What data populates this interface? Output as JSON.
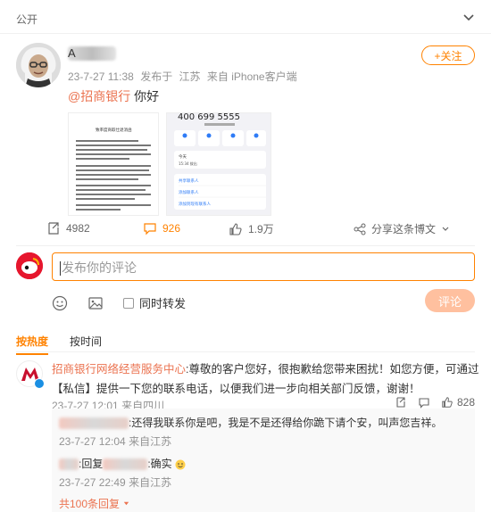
{
  "header": {
    "visibility": "公开"
  },
  "post": {
    "author_initial": "A",
    "time": "23-7-27 11:38",
    "published_from_label": "发布于",
    "location": "江苏",
    "source": "来自 iPhone客户端",
    "follow_label": "+关注",
    "mention": "@招商银行",
    "text": "你好",
    "shares": "4982",
    "comments": "926",
    "likes": "1.9万",
    "share_to": "分享这条博文"
  },
  "screenshot1": {
    "title": "致率度商取仕退消函"
  },
  "screenshot2": {
    "phone": "400 699 5555",
    "line1": "今天",
    "line2": "15:34 拨出",
    "link1": "共享联系人",
    "link2": "添加联系人",
    "link3": "添加到现有联系人"
  },
  "composer": {
    "placeholder": "发布你的评论",
    "repost_label": "同时转发",
    "submit_label": "评论"
  },
  "sort_tabs": {
    "hot": "按热度",
    "time": "按时间"
  },
  "comment": {
    "author": "招商银行网络经营服务中心",
    "text": ":尊敬的客户您好，很抱歉给您带来困扰！如您方便，可通过【私信】提供一下您的联系电话，以便我们进一步向相关部门反馈，谢谢！",
    "time": "23-7-27 12:01",
    "source": "来自四川",
    "likes": "828",
    "replies": [
      {
        "text": ":还得我联系你是吧，我是不是还得给你跪下请个安，叫声您吉祥。",
        "time": "23-7-27 12:04",
        "source": "来自江苏"
      },
      {
        "reply_prefix": ":回复",
        "text": ":确实",
        "time": "23-7-27 22:49",
        "source": "来自江苏"
      }
    ],
    "more_replies": "共100条回复"
  },
  "colors": {
    "accent": "#ff8200",
    "link": "#eb7350",
    "meta": "#939393"
  }
}
